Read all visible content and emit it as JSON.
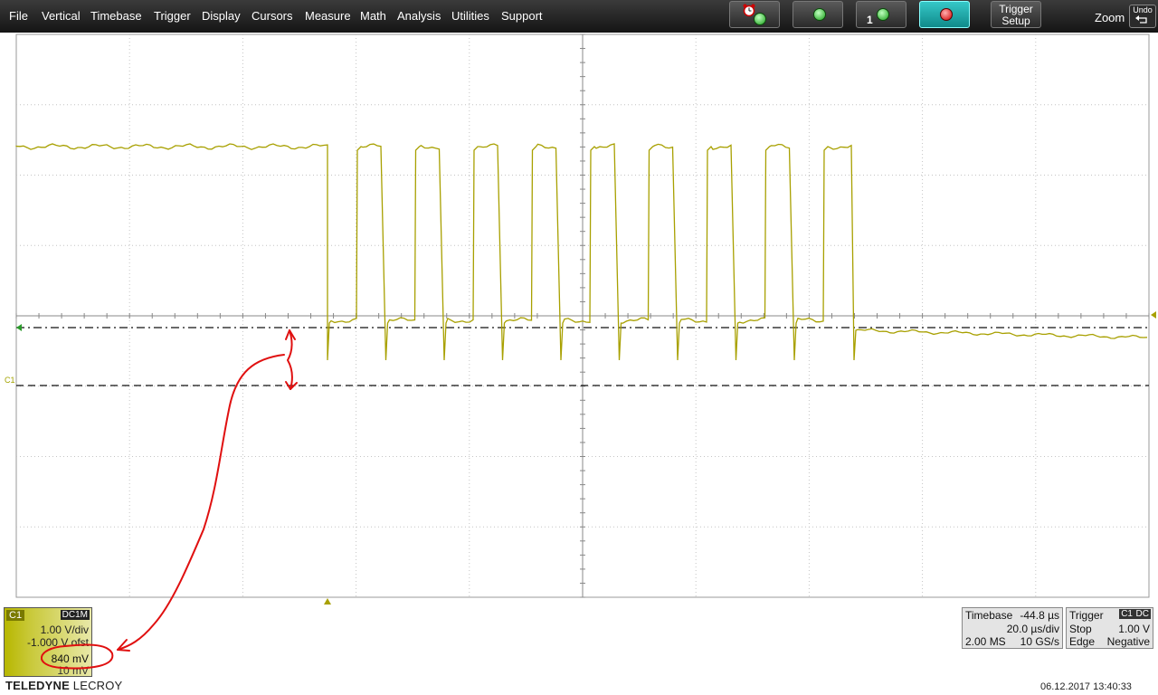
{
  "menu": [
    "File",
    "Vertical",
    "Timebase",
    "Trigger",
    "Display",
    "Cursors",
    "Measure",
    "Math",
    "Analysis",
    "Utilities",
    "Support"
  ],
  "toolbar": {
    "trigger_setup_line1": "Trigger",
    "trigger_setup_line2": "Setup",
    "zoom_label": "Zoom",
    "undo_label": "Undo",
    "single_marker": "1"
  },
  "icons": [
    "alarm-clock-icon",
    "green-led-icon",
    "green-led-icon",
    "red-led-icon",
    "undo-arrow-icon"
  ],
  "channel": {
    "tag": "C1",
    "coupling": "DC1M",
    "vdiv": "1.00 V/div",
    "offset": "-1.000 V ofst",
    "measure": "840 mV",
    "measure2": "10 mV",
    "trace_label": "C1"
  },
  "timebase": {
    "label": "Timebase",
    "delay": "-44.8 µs",
    "tdiv": "20.0 µs/div",
    "samples": "2.00 MS",
    "rate": "10 GS/s"
  },
  "trigger": {
    "label": "Trigger",
    "ch_tag": "C1",
    "coupling": "DC",
    "mode": "Stop",
    "level": "1.00 V",
    "type": "Edge",
    "slope": "Negative"
  },
  "brand": {
    "bold": "TELEDYNE",
    "thin": " LECROY"
  },
  "datetime": "06.12.2017 13:40:33",
  "colors": {
    "trace": "#a8a000",
    "grid": "#b8b8b8",
    "annotation": "#e01010",
    "active_button": "#1fb0b0"
  },
  "waveform": {
    "high_level_V": 2.4,
    "low_level_V": 0.0,
    "undershoot_V": -0.5,
    "pulse_count": 9
  }
}
